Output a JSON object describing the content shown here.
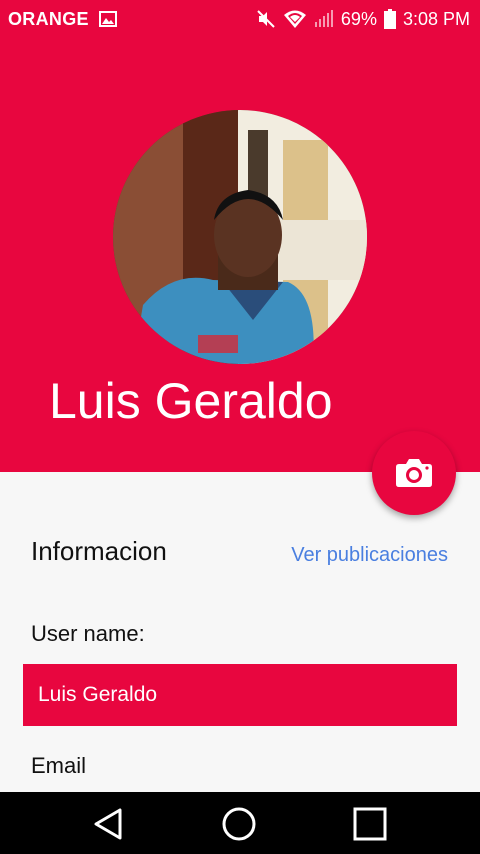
{
  "status_bar": {
    "carrier": "ORANGE",
    "battery": "69%",
    "time": "3:08 PM",
    "icons": [
      "image-notification-icon",
      "mute-icon",
      "wifi-icon",
      "signal-icon",
      "battery-icon"
    ]
  },
  "profile": {
    "name": "Luis Geraldo",
    "avatar_icon": "profile-photo"
  },
  "fab": {
    "icon": "camera-icon"
  },
  "info": {
    "title": "Informacion",
    "link_label": "Ver publicaciones",
    "username_label": "User name:",
    "username_value": "Luis Geraldo",
    "email_label": "Email"
  },
  "nav_bar": {
    "icons": [
      "back-icon",
      "home-icon",
      "recents-icon"
    ]
  },
  "colors": {
    "accent": "#e8063f",
    "link": "#4a7fe0",
    "background": "#f7f7f7"
  }
}
